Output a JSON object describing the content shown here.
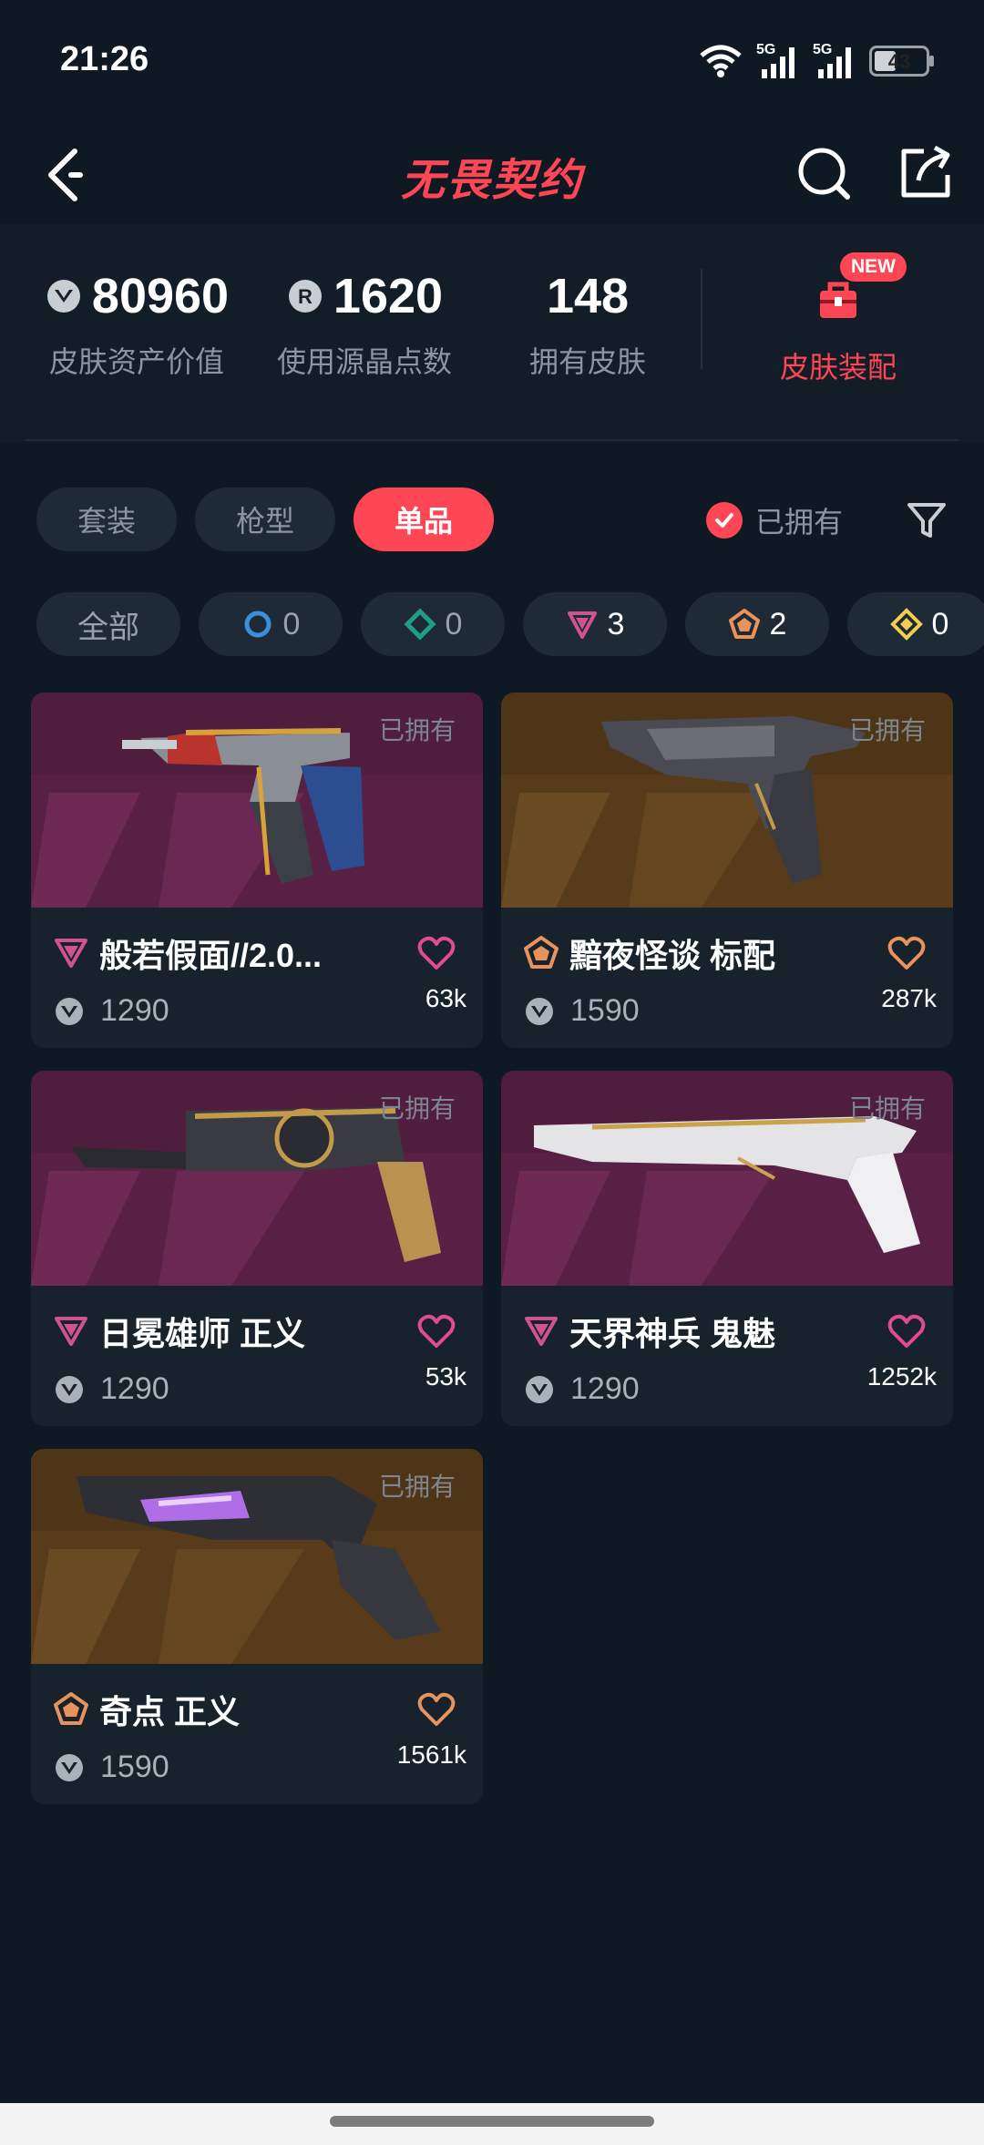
{
  "status": {
    "time": "21:26",
    "net1": "5G",
    "net2": "5G",
    "battery": "43"
  },
  "header": {
    "title": "无畏契约"
  },
  "stats": [
    {
      "value": "80960",
      "label": "皮肤资产价值",
      "icon": "vp-icon"
    },
    {
      "value": "1620",
      "label": "使用源晶点数",
      "icon": "radianite-icon"
    },
    {
      "value": "148",
      "label": "拥有皮肤",
      "icon": ""
    }
  ],
  "equip": {
    "label": "皮肤装配",
    "badge": "NEW"
  },
  "tabs": [
    "套装",
    "枪型",
    "单品"
  ],
  "owned_filter": {
    "label": "已拥有",
    "checked": true
  },
  "chips": [
    {
      "label": "全部"
    },
    {
      "count": "0",
      "tier": "select",
      "color": "#3a8fd8"
    },
    {
      "count": "0",
      "tier": "deluxe",
      "color": "#1e9e8a"
    },
    {
      "count": "3",
      "tier": "premium",
      "color": "#d1538c"
    },
    {
      "count": "2",
      "tier": "exclusive",
      "color": "#e8935c"
    },
    {
      "count": "0",
      "tier": "ultra",
      "color": "#f0d04a"
    }
  ],
  "cards": [
    {
      "name": "般若假面//2.0...",
      "price": "1290",
      "likes": "63k",
      "owned": "已拥有",
      "tier": "premium",
      "tier_color": "#d1538c",
      "heart_color": "#e04c8e"
    },
    {
      "name": "黯夜怪谈 标配",
      "price": "1590",
      "likes": "287k",
      "owned": "已拥有",
      "tier": "exclusive",
      "tier_color": "#e8935c",
      "heart_color": "#e8935c"
    },
    {
      "name": "日冕雄师 正义",
      "price": "1290",
      "likes": "53k",
      "owned": "已拥有",
      "tier": "premium",
      "tier_color": "#d1538c",
      "heart_color": "#e04c8e"
    },
    {
      "name": "天界神兵 鬼魅",
      "price": "1290",
      "likes": "1252k",
      "owned": "已拥有",
      "tier": "premium",
      "tier_color": "#d1538c",
      "heart_color": "#e04c8e"
    },
    {
      "name": "奇点 正义",
      "price": "1590",
      "likes": "1561k",
      "owned": "已拥有",
      "tier": "exclusive",
      "tier_color": "#e8935c",
      "heart_color": "#e8935c"
    }
  ],
  "colors": {
    "accent": "#ff4655",
    "bg": "#0f1923",
    "card": "#17222d",
    "premium_bg": "#55203f",
    "exclusive_bg": "#5a3d1c"
  }
}
